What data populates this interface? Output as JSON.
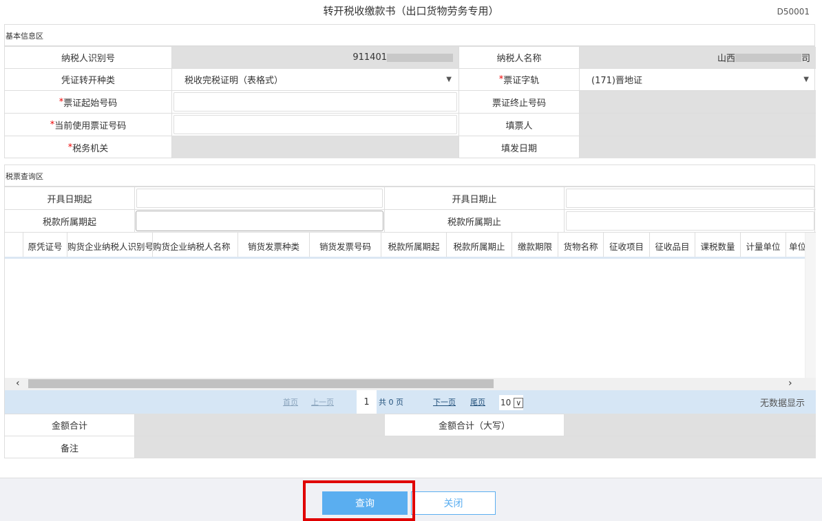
{
  "title": "转开税收缴款书（出口货物劳务专用）",
  "form_code": "D50001",
  "basic": {
    "section": "基本信息区",
    "taxpayer_id_label": "纳税人识别号",
    "taxpayer_id_value": "911401",
    "taxpayer_name_label": "纳税人名称",
    "taxpayer_name_prefix": "山西",
    "taxpayer_name_suffix": "司",
    "voucher_type_label": "凭证转开种类",
    "voucher_type_value": "税收完税证明（表格式）",
    "ticket_track_label": "票证字轨",
    "ticket_track_value": "(171)晋地证",
    "start_no_label": "票证起始号码",
    "end_no_label": "票证终止号码",
    "current_no_label": "当前使用票证号码",
    "filler_label": "填票人",
    "tax_office_label": "税务机关",
    "fill_date_label": "填发日期"
  },
  "query": {
    "section": "税票查询区",
    "issue_from_label": "开具日期起",
    "issue_to_label": "开具日期止",
    "period_from_label": "税款所属期起",
    "period_to_label": "税款所属期止"
  },
  "grid": {
    "columns": [
      "原凭证号",
      "购货企业纳税人识别号",
      "购货企业纳税人名称",
      "销货发票种类",
      "销货发票号码",
      "税款所属期起",
      "税款所属期止",
      "缴款期限",
      "货物名称",
      "征收项目",
      "征收品目",
      "课税数量",
      "计量单位",
      "单位"
    ]
  },
  "pager": {
    "first": "首页",
    "prev": "上一页",
    "page": "1",
    "total": "共 0 页",
    "next": "下一页",
    "last": "尾页",
    "page_size": "10",
    "empty": "无数据显示"
  },
  "totals": {
    "sum_label": "金额合计",
    "sum_upper_label": "金额合计（大写）",
    "remark_label": "备注"
  },
  "buttons": {
    "query": "查询",
    "close": "关闭"
  },
  "colors": {
    "primary": "#5aaef0",
    "highlight": "#e00000",
    "pager_bg": "#d6e6f5"
  }
}
